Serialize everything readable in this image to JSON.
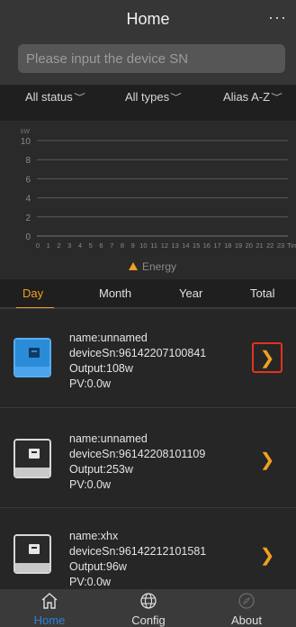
{
  "header": {
    "title": "Home",
    "more_icon": "more-dots-icon",
    "more_text": "···"
  },
  "search": {
    "placeholder": "Please input the device SN",
    "value": ""
  },
  "filters": {
    "status": "All status",
    "type": "All types",
    "sort": "Alias A-Z"
  },
  "chart": {
    "unit_label": "kW",
    "axis_end_label": "Tim",
    "legend_label": "Energy",
    "accent": "#f0a020"
  },
  "chart_data": {
    "type": "line",
    "title": "",
    "ylabel": "kW",
    "xlabel": "Tim",
    "ylim": [
      0,
      10
    ],
    "yticks": [
      0,
      2,
      4,
      6,
      8,
      10
    ],
    "x": [
      0,
      1,
      2,
      3,
      4,
      5,
      6,
      7,
      8,
      9,
      10,
      11,
      12,
      13,
      14,
      15,
      16,
      17,
      18,
      19,
      20,
      21,
      22,
      23
    ],
    "series": [
      {
        "name": "Energy",
        "values": []
      }
    ],
    "grid": true,
    "legend": "bottom-center"
  },
  "period_tabs": [
    {
      "label": "Day",
      "active": true
    },
    {
      "label": "Month",
      "active": false
    },
    {
      "label": "Year",
      "active": false
    },
    {
      "label": "Total",
      "active": false
    }
  ],
  "devices": [
    {
      "name": "name:unnamed",
      "sn": "deviceSn:96142207100841",
      "output": "Output:108w",
      "pv": "PV:0.0w",
      "icon": "inverter-icon",
      "status": "online",
      "selected": true
    },
    {
      "name": "name:unnamed",
      "sn": "deviceSn:96142208101109",
      "output": "Output:253w",
      "pv": "PV:0.0w",
      "icon": "inverter-icon",
      "status": "offline",
      "selected": false
    },
    {
      "name": "name:xhx",
      "sn": "deviceSn:96142212101581",
      "output": "Output:96w",
      "pv": "PV:0.0w",
      "icon": "inverter-icon",
      "status": "offline",
      "selected": false
    }
  ],
  "tabbar": {
    "items": [
      {
        "label": "Home",
        "icon": "home-icon",
        "active": true
      },
      {
        "label": "Config",
        "icon": "globe-icon",
        "active": false
      },
      {
        "label": "About",
        "icon": "compass-icon",
        "active": false
      }
    ]
  },
  "colors": {
    "accent": "#f0a020",
    "active_tab": "#2f7fd6",
    "online_device": "#2a8cd6",
    "selection_border": "#e4321f"
  }
}
